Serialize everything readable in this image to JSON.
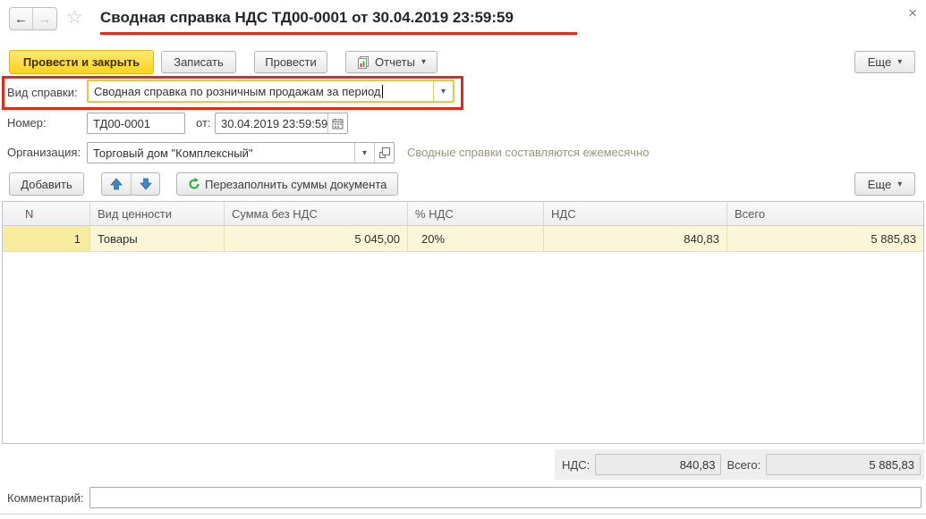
{
  "window": {
    "title": "Сводная справка НДС ТД00-0001 от 30.04.2019 23:59:59"
  },
  "icons": {
    "back": "←",
    "forward": "→",
    "star": "☆",
    "close": "×",
    "dropdown": "▾"
  },
  "command_bar": {
    "post_and_close": "Провести и закрыть",
    "write": "Записать",
    "post": "Провести",
    "reports": "Отчеты",
    "more": "Еще"
  },
  "fields": {
    "kind_label": "Вид справки:",
    "kind_value": "Сводная справка по розничным продажам за период",
    "number_label": "Номер:",
    "number_value": "ТД00-0001",
    "date_label": "от:",
    "date_value": "30.04.2019 23:59:59",
    "org_label": "Организация:",
    "org_value": "Торговый дом \"Комплексный\"",
    "org_hint": "Сводные справки составляются ежемесячно",
    "comment_label": "Комментарий:",
    "comment_value": ""
  },
  "grid_toolbar": {
    "add": "Добавить",
    "refill": "Перезаполнить суммы документа",
    "more": "Еще"
  },
  "table": {
    "columns": [
      "N",
      "Вид ценности",
      "Сумма без НДС",
      "% НДС",
      "НДС",
      "Всего"
    ],
    "rows": [
      {
        "n": "1",
        "kind": "Товары",
        "sum_no_vat": "5 045,00",
        "vat_rate": "20%",
        "vat": "840,83",
        "total": "5 885,83"
      }
    ]
  },
  "totals": {
    "vat_label": "НДС:",
    "vat_value": "840,83",
    "total_label": "Всего:",
    "total_value": "5 885,83"
  },
  "colors": {
    "accent_yellow": "#ffd21e",
    "annotation_red": "#dd2b1c",
    "focus_border": "#ecc63f",
    "row_highlight": "#fcf6d8"
  }
}
